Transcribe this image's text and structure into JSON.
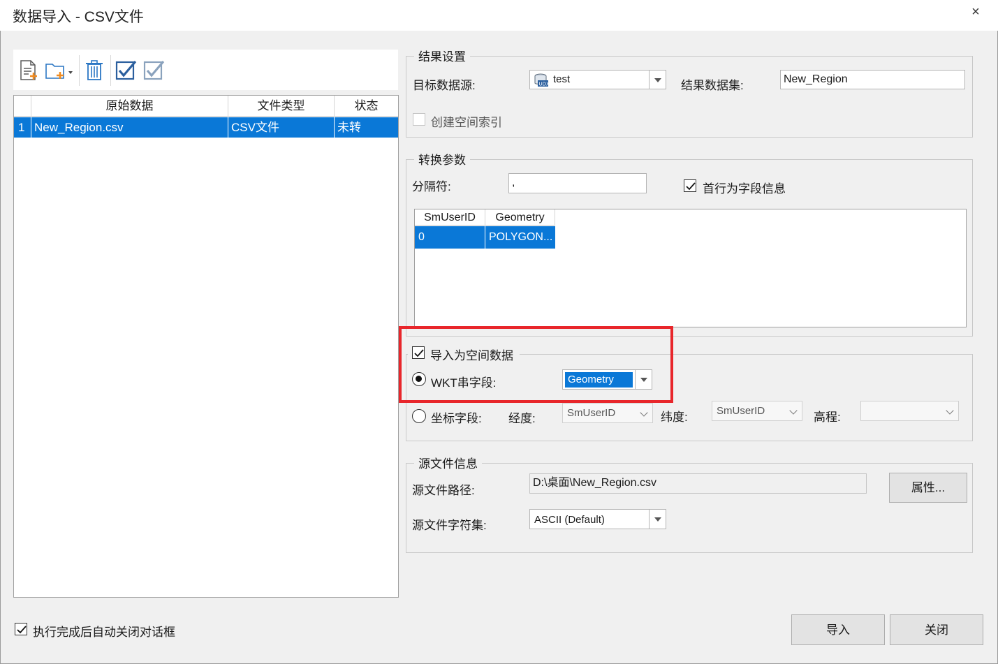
{
  "window": {
    "title": "数据导入 - CSV文件",
    "close_glyph": "×"
  },
  "toolbar": {
    "icons": [
      "add-file-icon",
      "add-folder-icon",
      "delete-icon",
      "select-all-icon",
      "invert-select-icon"
    ]
  },
  "file_table": {
    "headers": [
      "原始数据",
      "文件类型",
      "状态"
    ],
    "rows": [
      {
        "index": "1",
        "source": "New_Region.csv",
        "type": "CSV文件",
        "status": "未转"
      }
    ]
  },
  "result_settings": {
    "group_label": "结果设置",
    "target_datasource_label": "目标数据源:",
    "target_datasource_value": "test",
    "result_dataset_label": "结果数据集:",
    "result_dataset_value": "New_Region",
    "spatial_index_label": "创建空间索引",
    "spatial_index_checked": false
  },
  "conversion": {
    "group_label": "转换参数",
    "separator_label": "分隔符:",
    "separator_value": ",",
    "first_row_label": "首行为字段信息",
    "first_row_checked": true,
    "preview_headers": [
      "SmUserID",
      "Geometry"
    ],
    "preview_rows": [
      [
        "0",
        "POLYGON..."
      ]
    ]
  },
  "spatial": {
    "import_label": "导入为空间数据",
    "import_checked": true,
    "wkt_label": "WKT串字段:",
    "wkt_value": "Geometry",
    "coord_label": "坐标字段:",
    "lon_label": "经度:",
    "lon_value": "SmUserID",
    "lat_label": "纬度:",
    "lat_value": "SmUserID",
    "elev_label": "高程:",
    "elev_value": "",
    "highlight_color": "#e8262b"
  },
  "source_info": {
    "group_label": "源文件信息",
    "path_label": "源文件路径:",
    "path_value": "D:\\桌面\\New_Region.csv",
    "props_button": "属性...",
    "charset_label": "源文件字符集:",
    "charset_value": "ASCII (Default)"
  },
  "footer": {
    "auto_close_label": "执行完成后自动关闭对话框",
    "auto_close_checked": true,
    "import_button": "导入",
    "close_button": "关闭"
  },
  "colors": {
    "selection": "#0a78d7",
    "accent_blue": "#1f6fb5"
  }
}
